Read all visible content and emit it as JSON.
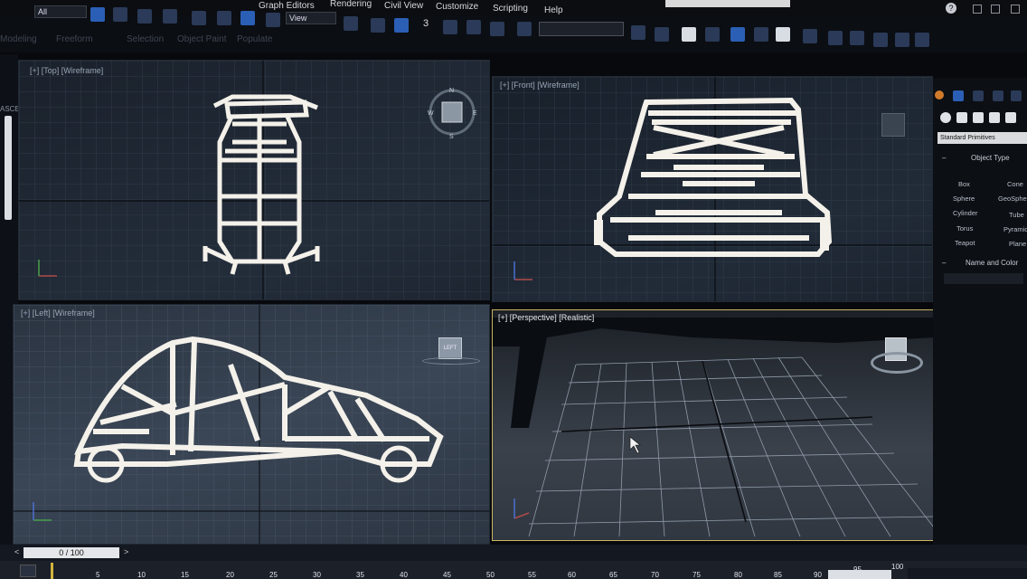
{
  "app": {
    "menus": [
      "Graph Editors",
      "Rendering",
      "Civil View",
      "Customize",
      "Scripting",
      "Help"
    ],
    "selection_filter": "All",
    "reference_coord": "View",
    "ribbon_tabs": [
      "Modeling",
      "Freeform",
      "Selection",
      "Object Paint",
      "Populate"
    ],
    "snap_value": "3",
    "sidebar_text": "ASCE"
  },
  "viewports": {
    "top": {
      "label": "[+] [Top] [Wireframe]",
      "viewcube": {
        "n": "N",
        "w": "W",
        "e": "E",
        "s": "S"
      }
    },
    "front": {
      "label": "[+] [Front] [Wireframe]"
    },
    "left": {
      "label": "[+] [Left] [Wireframe]",
      "viewcube_label": "LEFT"
    },
    "perspective": {
      "label": "[+] [Perspective] [Realistic]"
    }
  },
  "command_panel": {
    "dropdown": "Standard Primitives",
    "object_type_title": "Object Type",
    "primitives": [
      {
        "left": "Box",
        "right": "Cone"
      },
      {
        "left": "Sphere",
        "right": "GeoSphere"
      },
      {
        "left": "Cylinder",
        "right": "Tube"
      },
      {
        "left": "Torus",
        "right": "Pyramid"
      },
      {
        "left": "Teapot",
        "right": "Plane"
      }
    ],
    "name_color_title": "Name and Color"
  },
  "timeline": {
    "frame_display": "0 / 100",
    "ticks": [
      "5",
      "10",
      "15",
      "20",
      "25",
      "30",
      "35",
      "40",
      "45",
      "50",
      "55",
      "60",
      "65",
      "70",
      "75",
      "80",
      "85",
      "90",
      "95",
      "100"
    ]
  },
  "colors": {
    "active_border": "#c9b464",
    "wireframe": "#f4f1ea",
    "viewport_bg": "#202a37"
  }
}
